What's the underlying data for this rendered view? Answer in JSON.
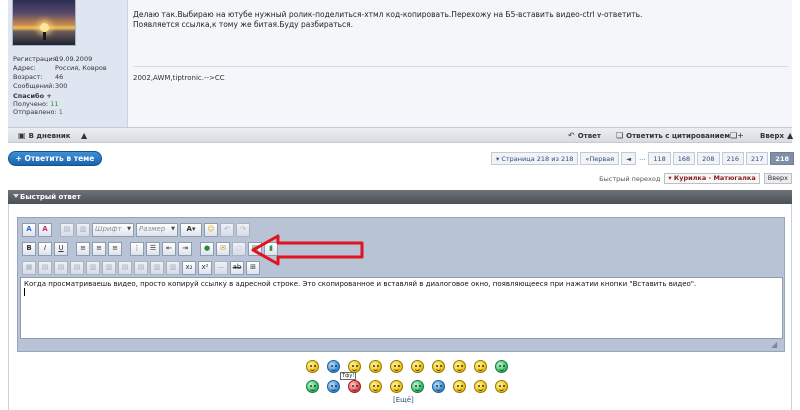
{
  "post": {
    "user": {
      "registration_label": "Регистрация:",
      "registration_value": "19.09.2009",
      "address_label": "Адрес:",
      "address_value": "Россия, Ковров",
      "age_label": "Возраст:",
      "age_value": "46",
      "messages_label": "Сообщений:",
      "messages_value": "300",
      "thanks_label": "Спасибо +",
      "received_label": "Получено:",
      "received_value": "11",
      "sent_label": "Отправлено:",
      "sent_value": "1"
    },
    "text_line1": "Делаю так.Выбираю на ютубе нужный ролик-поделиться-хтмл код-копировать.Перехожу на Б5-вставить видео-ctrl v-ответить.",
    "text_line2": "Появляется ссылка,к тому же битая.Буду разбираться.",
    "signature": "2002,AWM,tiptronic.-->CC",
    "controls": {
      "diary": "В дневник",
      "reply": "Ответ",
      "quote": "Ответить с цитированием",
      "top": "Вверх"
    }
  },
  "reply_button": "+ Ответить в теме",
  "pagination": {
    "page_info": "Страница 218 из 218",
    "first": "Первая",
    "prev": "◄",
    "ellipsis": "...",
    "pages": [
      "118",
      "168",
      "208",
      "216",
      "217"
    ],
    "current": "218"
  },
  "quick_nav": {
    "label": "Быстрый переход",
    "select": "Курилка - Матюгалка",
    "button": "Вверх"
  },
  "quick_reply": {
    "title": "Быстрый ответ",
    "font_select": "Шрифт",
    "size_select": "Размер",
    "text": "Когда просматриваешь видео, просто копируй ссылку в адресной строке. Это скопированное и вставляй в диалоговое окно, появляющееся при нажатии кнопки \"Вставить видео\".",
    "tooltip": "Тфу!",
    "more_link": "[Ещё]"
  },
  "colors": {
    "accent_blue": "#1a62ad",
    "arrow_red": "#e0141e",
    "current_page": "#7f8fa8"
  }
}
